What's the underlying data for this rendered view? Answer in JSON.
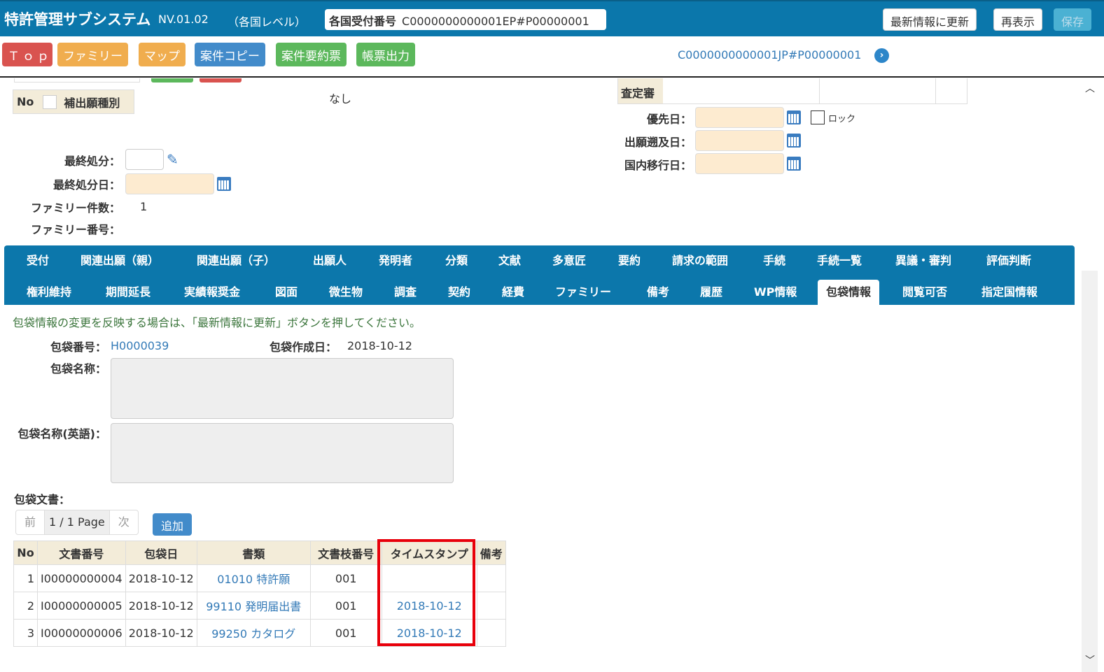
{
  "header": {
    "title": "特許管理サブシステム",
    "version": "NV.01.02",
    "level": "（各国レベル）",
    "receipt_label": "各国受付番号",
    "receipt_value": "C0000000000001EP#P00000001",
    "update_button": "最新情報に更新",
    "redisplay_button": "再表示",
    "save_button": "保存"
  },
  "nav": {
    "buttons": [
      {
        "label": "Ｔｏｐ",
        "color": "#d9534f"
      },
      {
        "label": "ファミリー",
        "color": "#f0ad4e"
      },
      {
        "label": "マップ",
        "color": "#f0ad4e"
      },
      {
        "label": "案件コピー",
        "color": "#428bca"
      },
      {
        "label": "案件要約票",
        "color": "#5cb85c"
      },
      {
        "label": "帳票出力",
        "color": "#5cb85c"
      }
    ],
    "case_link": "C0000000000001JP#P00000001"
  },
  "upper": {
    "no_header": "No",
    "supplement_header": "補出願種別",
    "representative_value": "なし",
    "examiner_label": "査定審",
    "final_disposition_label": "最終処分：",
    "final_disposition_date_label": "最終処分日：",
    "family_count_label": "ファミリー件数：",
    "family_count_value": "1",
    "family_number_label": "ファミリー番号：",
    "priority_date_label": "優先日：",
    "lock_label": "ロック",
    "retro_date_label": "出願遡及日：",
    "national_entry_label": "国内移行日："
  },
  "tabs": {
    "row1": [
      "受付",
      "関連出願（親）",
      "関連出願（子）",
      "出願人",
      "発明者",
      "分類",
      "文献",
      "多意匠",
      "要約",
      "請求の範囲",
      "手続",
      "手続一覧",
      "異議・審判",
      "評価判断"
    ],
    "row2": [
      "権利維持",
      "期間延長",
      "実績報奨金",
      "図面",
      "微生物",
      "調査",
      "契約",
      "経費",
      "ファミリー",
      "備考",
      "履歴",
      "WP情報",
      "包袋情報",
      "閲覧可否",
      "指定国情報"
    ],
    "active": "包袋情報"
  },
  "wrapper": {
    "notice": "包袋情報の変更を反映する場合は、「最新情報に更新」ボタンを押してください。",
    "number_label": "包袋番号：",
    "number_value": "H0000039",
    "created_label": "包袋作成日：",
    "created_value": "2018-10-12",
    "name_label": "包袋名称：",
    "name_en_label": "包袋名称(英語)：",
    "docs_label": "包袋文書："
  },
  "pager": {
    "prev": "前",
    "page": "1 / 1 Page",
    "next": "次",
    "add": "追加"
  },
  "docs_table": {
    "headers": [
      "No",
      "文書番号",
      "包袋日",
      "書類",
      "文書枝番号",
      "タイムスタンプ",
      "備考"
    ],
    "rows": [
      [
        "1",
        "I00000000004",
        "2018-10-12",
        "01010 特許願",
        "001",
        "",
        ""
      ],
      [
        "2",
        "I00000000005",
        "2018-10-12",
        "99110 発明届出書",
        "001",
        "2018-10-12",
        ""
      ],
      [
        "3",
        "I00000000006",
        "2018-10-12",
        "99250 カタログ",
        "001",
        "2018-10-12",
        ""
      ]
    ]
  },
  "highlight_color": "#e8000b"
}
